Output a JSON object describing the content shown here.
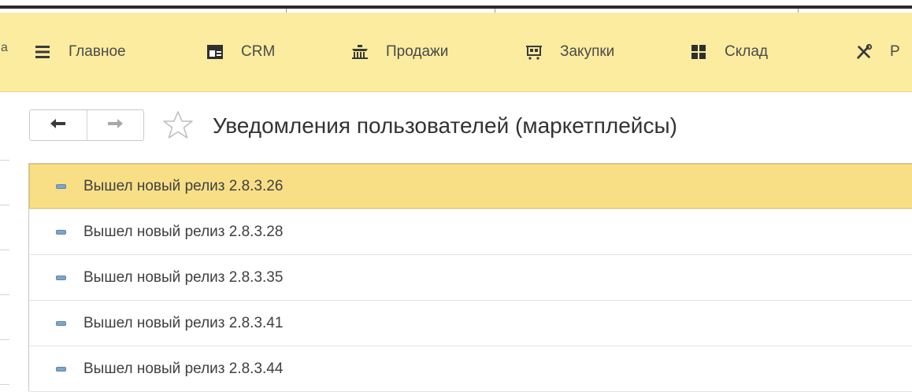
{
  "sections_panel": {
    "cut_glyph": "а",
    "items": [
      {
        "label": "Главное",
        "icon": "hamburger-menu-icon"
      },
      {
        "label": "CRM",
        "icon": "contact-card-icon"
      },
      {
        "label": "Продажи",
        "icon": "shop-basket-icon"
      },
      {
        "label": "Закупки",
        "icon": "cart-icon"
      },
      {
        "label": "Склад",
        "icon": "warehouse-grid-icon"
      },
      {
        "label": "Р",
        "icon": "tools-icon"
      }
    ]
  },
  "form": {
    "title": "Уведомления пользователей (маркетплейсы)",
    "nav_back_icon": "arrow-left-icon",
    "nav_forward_icon": "arrow-right-icon",
    "favorite_icon": "star-outline-icon"
  },
  "list": {
    "rows": [
      {
        "label": "Вышел новый релиз 2.8.3.26",
        "selected": true
      },
      {
        "label": "Вышел новый релиз 2.8.3.28",
        "selected": false
      },
      {
        "label": "Вышел новый релиз 2.8.3.35",
        "selected": false
      },
      {
        "label": "Вышел новый релиз 2.8.3.41",
        "selected": false
      },
      {
        "label": "Вышел новый релиз 2.8.3.44",
        "selected": false
      }
    ]
  },
  "colors": {
    "panel_bg": "#fbeca0",
    "selected_row": "#f8df86",
    "row_marker": "#7fa5c9"
  }
}
